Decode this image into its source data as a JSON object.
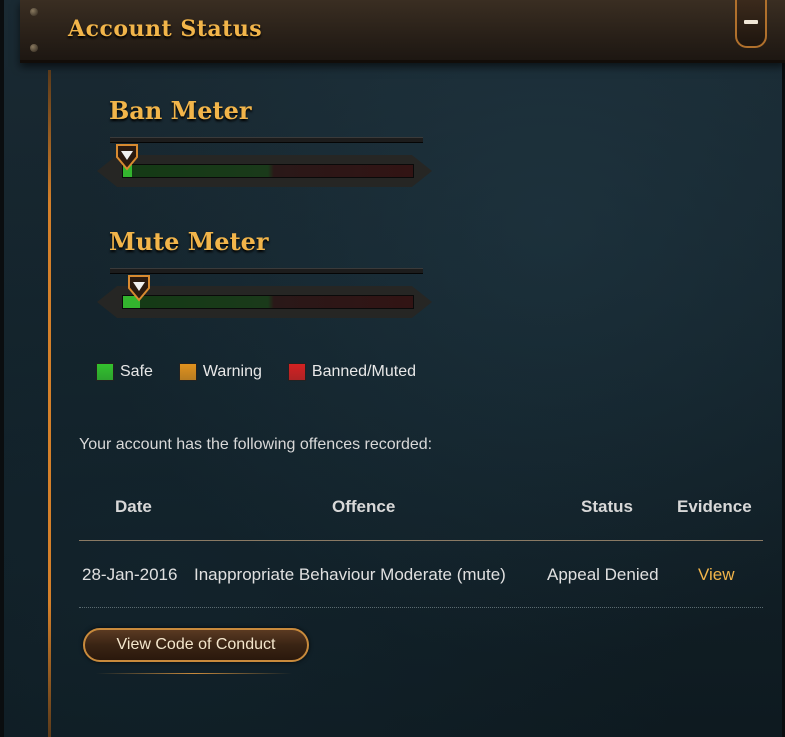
{
  "header": {
    "title": "Account Status",
    "collapse_icon": "minus-icon"
  },
  "ban_meter": {
    "title": "Ban Meter",
    "level": 0.03
  },
  "mute_meter": {
    "title": "Mute Meter",
    "level": 0.06
  },
  "legend": [
    {
      "label": "Safe",
      "color": "#33c22e"
    },
    {
      "label": "Warning",
      "color": "#e0921e"
    },
    {
      "label": "Banned/Muted",
      "color": "#d42222"
    }
  ],
  "offences": {
    "intro": "Your account has the following offences recorded:",
    "headers": {
      "date": "Date",
      "offence": "Offence",
      "status": "Status",
      "evidence": "Evidence"
    },
    "rows": [
      {
        "date": "28-Jan-2016",
        "offence": "Inappropriate Behaviour Moderate (mute)",
        "status": "Appeal Denied",
        "evidence": "View"
      }
    ]
  },
  "buttons": {
    "code_of_conduct": "View Code of Conduct"
  },
  "colors": {
    "accent": "#f2b54a",
    "link": "#f2b54a"
  }
}
